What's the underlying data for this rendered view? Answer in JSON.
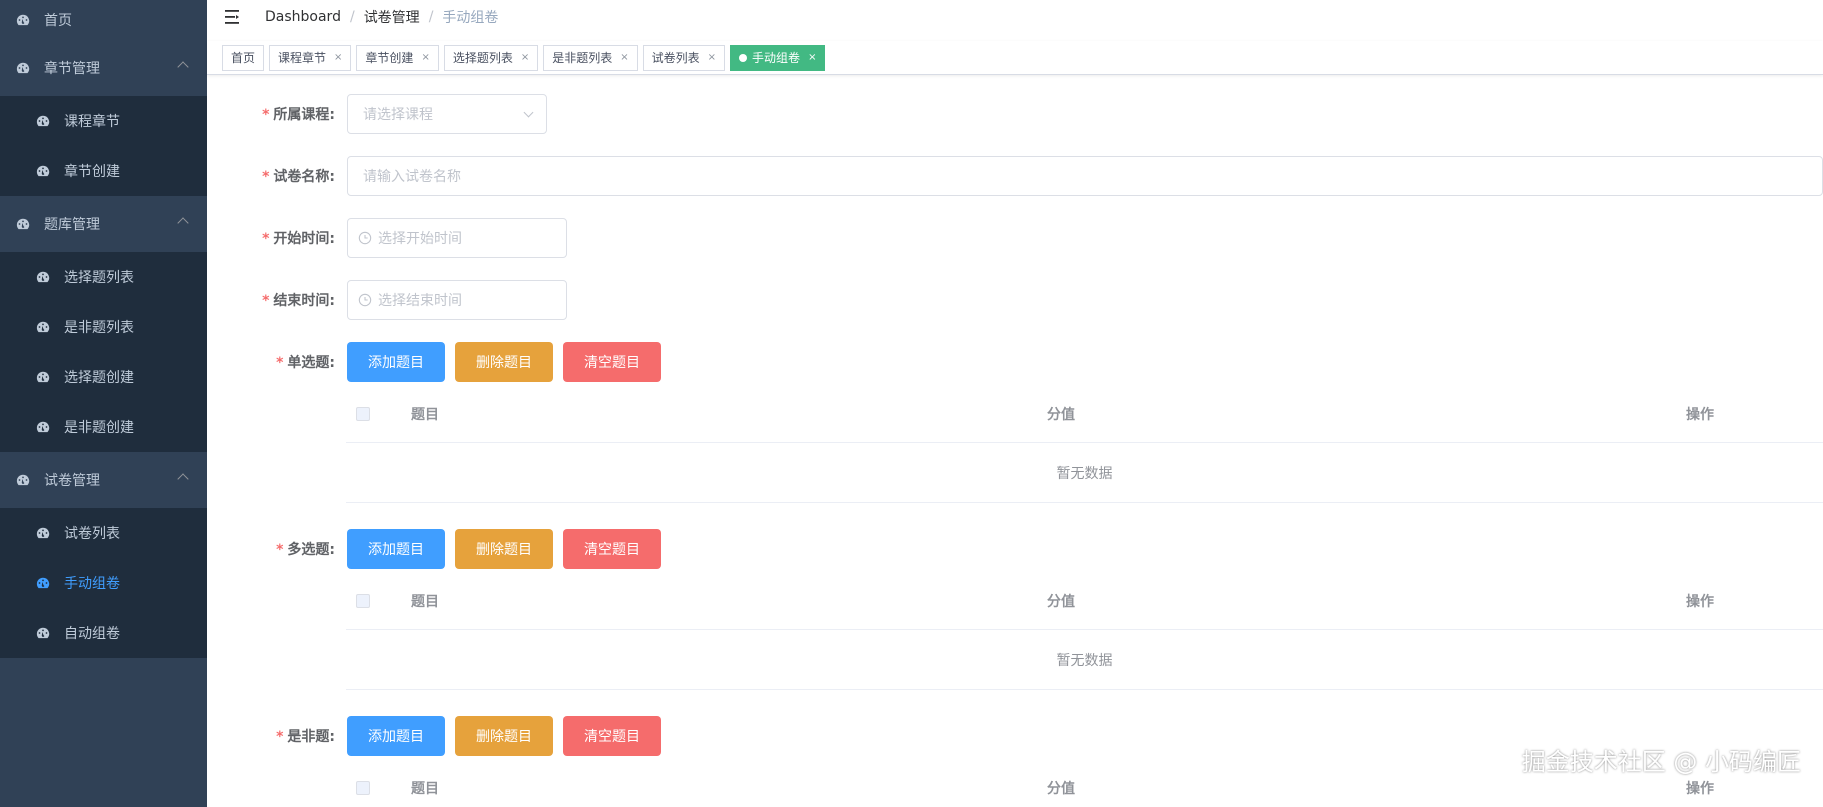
{
  "sidebar": {
    "home": "首页",
    "groups": [
      {
        "title": "章节管理",
        "items": [
          "课程章节",
          "章节创建"
        ]
      },
      {
        "title": "题库管理",
        "items": [
          "选择题列表",
          "是非题列表",
          "选择题创建",
          "是非题创建"
        ]
      },
      {
        "title": "试卷管理",
        "items": [
          "试卷列表",
          "手动组卷",
          "自动组卷"
        ]
      }
    ]
  },
  "navbar": {
    "breadcrumb": [
      "Dashboard",
      "试卷管理",
      "手动组卷"
    ],
    "separator": "/"
  },
  "tags": [
    {
      "label": "首页",
      "closable": false
    },
    {
      "label": "课程章节",
      "closable": true
    },
    {
      "label": "章节创建",
      "closable": true
    },
    {
      "label": "选择题列表",
      "closable": true
    },
    {
      "label": "是非题列表",
      "closable": true
    },
    {
      "label": "试卷列表",
      "closable": true
    },
    {
      "label": "手动组卷",
      "closable": true,
      "active": true
    }
  ],
  "tag_close": "×",
  "form": {
    "course": {
      "label": "所属课程:",
      "placeholder": "请选择课程"
    },
    "name": {
      "label": "试卷名称:",
      "placeholder": "请输入试卷名称"
    },
    "start": {
      "label": "开始时间:",
      "placeholder": "选择开始时间"
    },
    "end": {
      "label": "结束时间:",
      "placeholder": "选择结束时间"
    },
    "required_mark": "*",
    "sections": [
      {
        "label": "单选题:"
      },
      {
        "label": "多选题:"
      },
      {
        "label": "是非题:"
      }
    ],
    "buttons": {
      "add": "添加题目",
      "delete": "删除题目",
      "clear": "清空题目"
    },
    "table": {
      "col_title": "题目",
      "col_score": "分值",
      "col_op": "操作",
      "empty": "暂无数据"
    }
  },
  "watermark": "掘金技术社区 @ 小码编匠",
  "colors": {
    "sidebar_bg": "#304156",
    "submenu_bg": "#1f2d3d",
    "active_menu": "#409eff",
    "active_tag": "#42b983",
    "primary": "#409eff",
    "warning": "#e6a23c",
    "danger": "#f56c6c"
  }
}
